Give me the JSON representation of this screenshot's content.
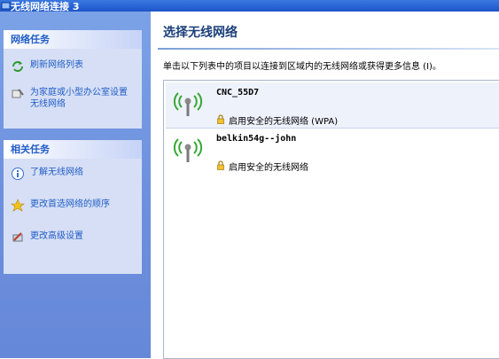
{
  "window": {
    "title": "无线网络连接 3"
  },
  "sidebar": {
    "network_tasks": {
      "header": "网络任务",
      "items": [
        {
          "label": "刷新网络列表",
          "icon": "refresh-icon"
        },
        {
          "label": "为家庭或小型办公室设置无线网络",
          "icon": "setup-wizard-icon"
        }
      ]
    },
    "related_tasks": {
      "header": "相关任务",
      "items": [
        {
          "label": "了解无线网络",
          "icon": "info-icon"
        },
        {
          "label": "更改首选网络的顺序",
          "icon": "star-icon"
        },
        {
          "label": "更改高级设置",
          "icon": "settings-icon"
        }
      ]
    }
  },
  "main": {
    "title": "选择无线网络",
    "description": "单击以下列表中的项目以连接到区域内的无线网络或获得更多信息 (I)。",
    "networks": [
      {
        "ssid": "CNC_55D7",
        "security": "启用安全的无线网络 (WPA)",
        "selected": true
      },
      {
        "ssid": "belkin54g--john",
        "security": "启用安全的无线网络",
        "selected": false
      }
    ]
  },
  "colors": {
    "sidebar": "#6f91dc",
    "panel": "#d6dff5",
    "link": "#215dc6",
    "title_bar": "#2a66d6"
  }
}
